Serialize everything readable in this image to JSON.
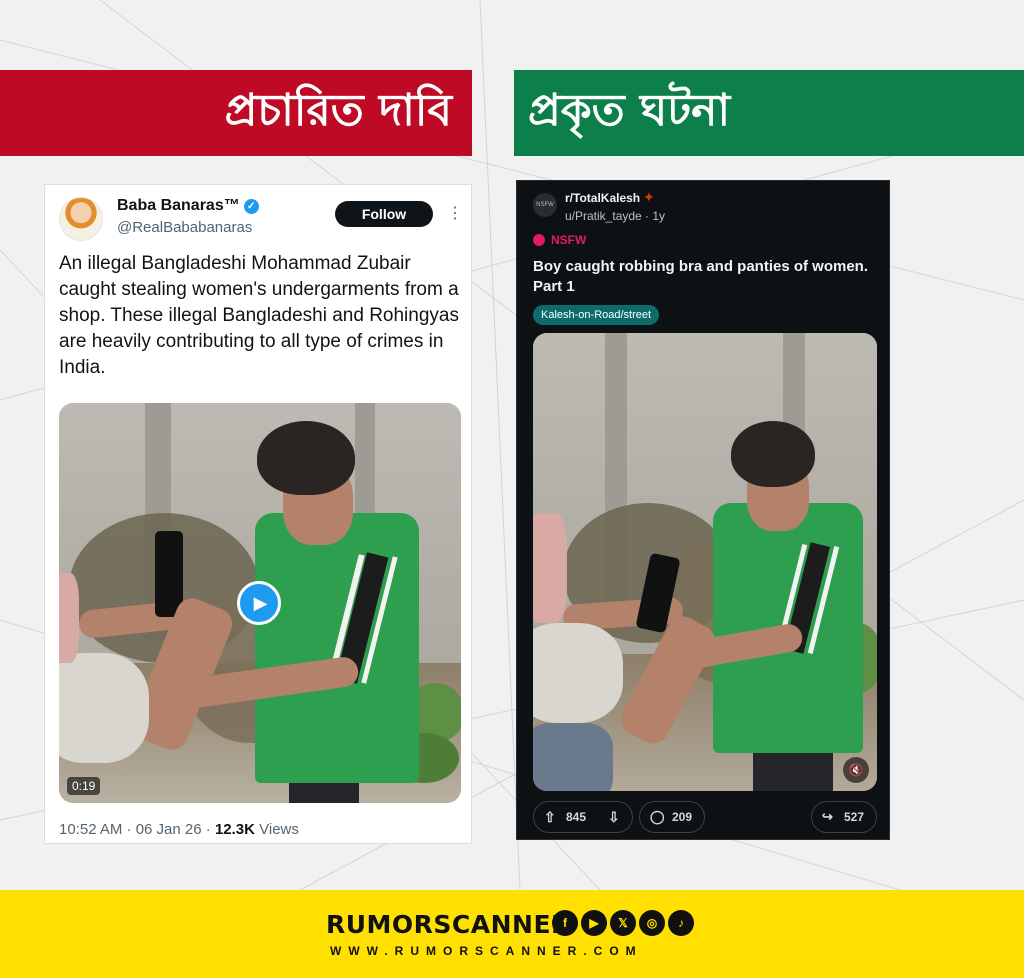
{
  "banners": {
    "claim": "প্রচারিত দাবি",
    "fact": "প্রকৃত ঘটনা"
  },
  "tweet": {
    "name": "Baba Banaras™",
    "handle": "@RealBababanaras",
    "follow_label": "Follow",
    "more_icon": "⋮",
    "text": "An illegal Bangladeshi Mohammad Zubair caught stealing women's undergarments from a shop. These illegal Bangladeshi and Rohingyas are heavily contributing to all type of crimes in India.",
    "video_duration": "0:19",
    "time_date": "10:52 AM · 06 Jan 26 · ",
    "views_count": "12.3K",
    "views_label": " Views",
    "verified_color": "#1d9bf0"
  },
  "reddit": {
    "avatar_text": "NSFW",
    "subreddit": "r/TotalKalesh",
    "user_time": "u/Pratik_tayde · 1y",
    "nsfw_label": "NSFW",
    "title": "Boy caught robbing bra and panties of women. Part 1",
    "tag": "Kalesh-on-Road/street",
    "upvotes": "845",
    "comments": "209",
    "shares": "527",
    "accent": "#e01a6b",
    "tag_color": "#0c6b6b"
  },
  "footer": {
    "brand": "RUMORSCANNER",
    "url": "WWW.RUMORSCANNER.COM",
    "socials": [
      "f",
      "▶",
      "𝕏",
      "◎",
      "♪"
    ],
    "bg_color": "#ffe000"
  },
  "colors": {
    "claim_red": "#bf0a26",
    "fact_green": "#0c7f4a"
  }
}
